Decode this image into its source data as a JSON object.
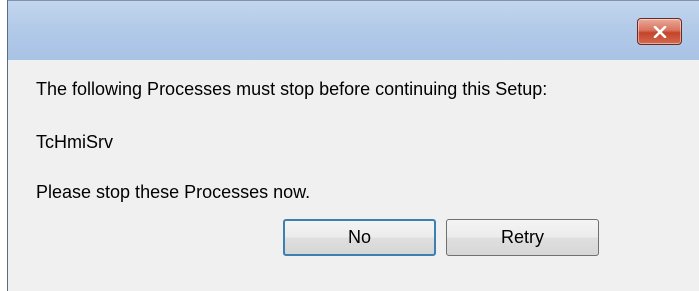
{
  "dialog": {
    "close_icon": "close-x-icon",
    "message_line1": "The following Processes must stop before continuing this Setup:",
    "process_name": "TcHmiSrv",
    "message_line3": "Please stop these Processes now.",
    "buttons": {
      "no_label": "No",
      "retry_label": "Retry"
    }
  },
  "colors": {
    "title_bar": "#b3cae8",
    "close_button": "#c5442a",
    "dialog_background": "#f0f0f0",
    "default_button_border": "#3c7fb1"
  }
}
